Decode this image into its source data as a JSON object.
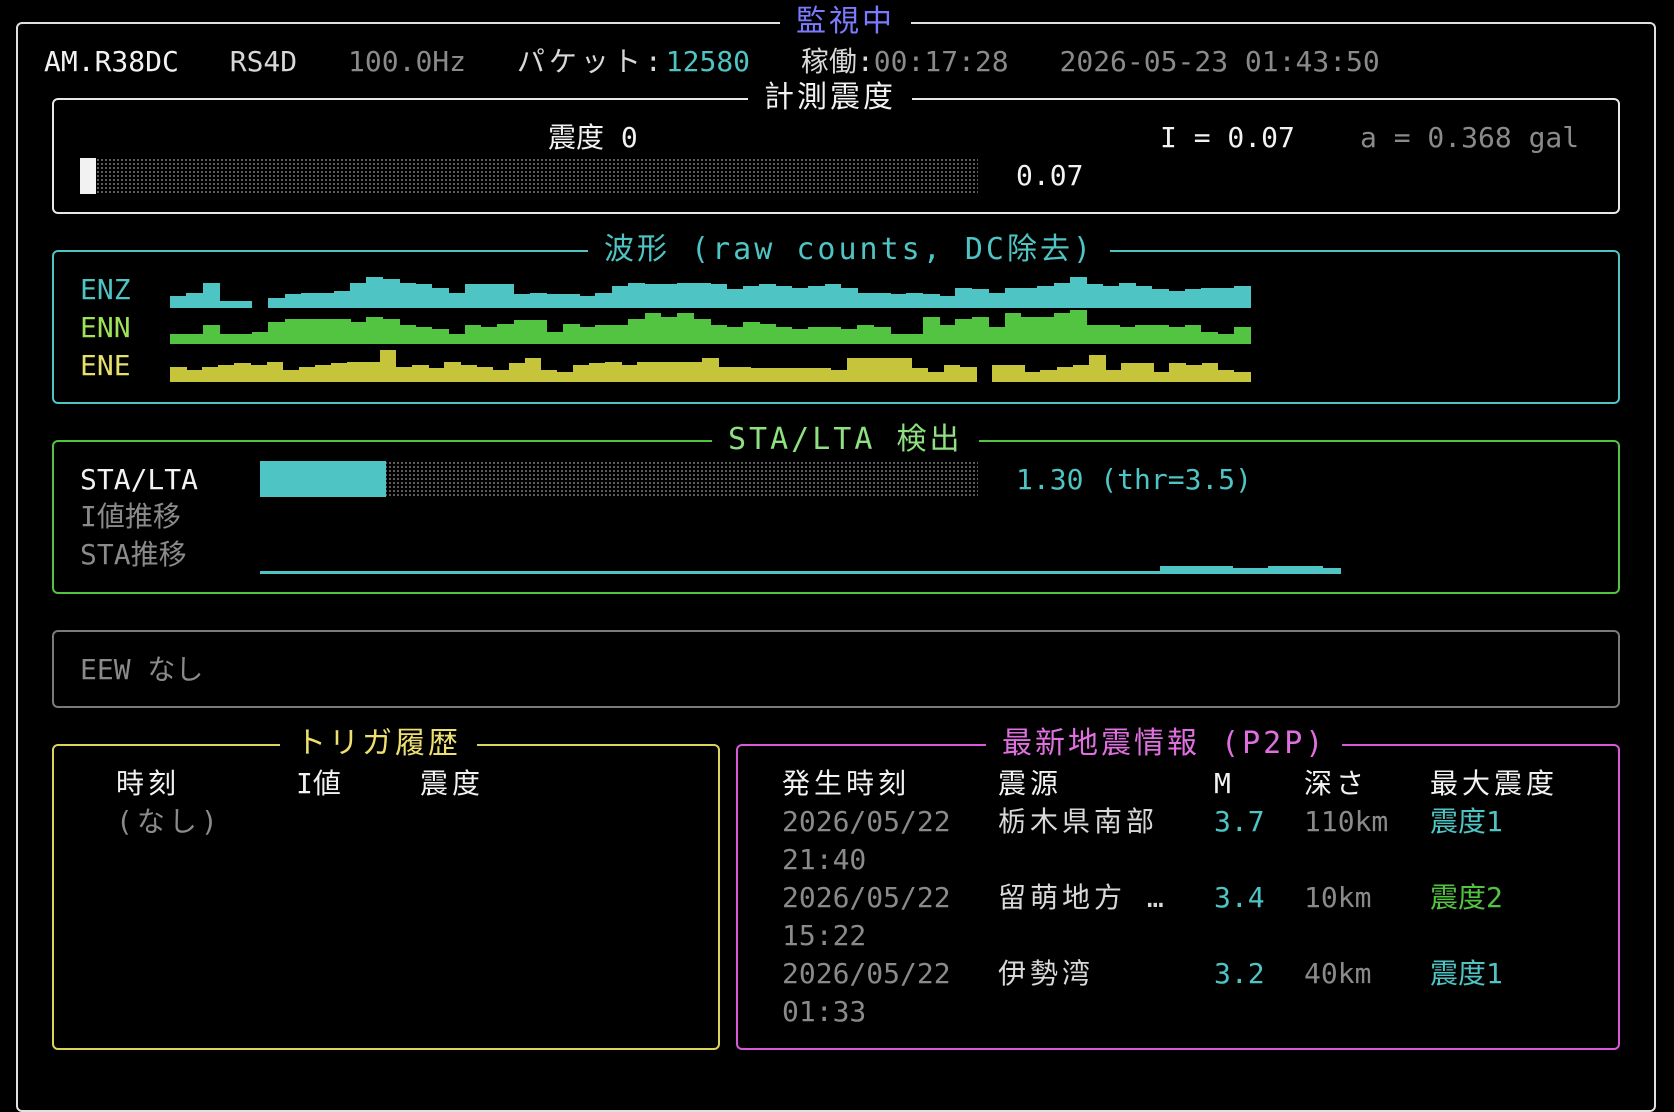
{
  "app": {
    "status_title": "監視中",
    "station": "AM.R38DC",
    "device": "RS4D",
    "rate": "100.0Hz",
    "packet_label": "パケット:",
    "packet_value": "12580",
    "uptime_label": "稼働:",
    "uptime_value": "00:17:28",
    "datetime": "2026-05-23 01:43:50"
  },
  "intensity": {
    "title": "計測震度",
    "shindo_label": "震度 0",
    "i_value_label": "I = 0.07",
    "accel_label": "a = 0.368 gal",
    "bar_value_text": "0.07",
    "bar_fraction": 0.011
  },
  "waveform": {
    "title": "波形 (raw counts, DC除去)",
    "channels": [
      {
        "name": "ENZ",
        "color": "#4fc4c4",
        "bins": [
          0.35,
          0.45,
          0.75,
          0.2,
          0.2,
          0,
          0.3,
          0.4,
          0.45,
          0.45,
          0.5,
          0.75,
          0.9,
          0.85,
          0.75,
          0.7,
          0.6,
          0.45,
          0.7,
          0.7,
          0.7,
          0.4,
          0.45,
          0.4,
          0.4,
          0.35,
          0.45,
          0.65,
          0.75,
          0.7,
          0.7,
          0.75,
          0.75,
          0.7,
          0.55,
          0.65,
          0.7,
          0.65,
          0.6,
          0.65,
          0.7,
          0.6,
          0.45,
          0.45,
          0.4,
          0.45,
          0.4,
          0.35,
          0.6,
          0.55,
          0.45,
          0.6,
          0.6,
          0.65,
          0.75,
          0.9,
          0.7,
          0.65,
          0.75,
          0.65,
          0.55,
          0.5,
          0.55,
          0.6,
          0.6,
          0.65
        ]
      },
      {
        "name": "ENN",
        "color": "#52c441",
        "bins": [
          0.3,
          0.3,
          0.55,
          0.3,
          0.3,
          0.35,
          0.65,
          0.75,
          0.75,
          0.75,
          0.75,
          0.65,
          0.8,
          0.75,
          0.55,
          0.5,
          0.45,
          0.3,
          0.55,
          0.5,
          0.6,
          0.7,
          0.7,
          0.35,
          0.6,
          0.5,
          0.55,
          0.55,
          0.75,
          0.9,
          0.8,
          0.9,
          0.75,
          0.55,
          0.5,
          0.65,
          0.6,
          0.5,
          0.45,
          0.5,
          0.5,
          0.45,
          0.55,
          0.5,
          0.3,
          0.3,
          0.8,
          0.55,
          0.75,
          0.8,
          0.5,
          0.9,
          0.8,
          0.8,
          0.9,
          1.0,
          0.55,
          0.55,
          0.5,
          0.55,
          0.55,
          0.5,
          0.55,
          0.35,
          0.3,
          0.5
        ]
      },
      {
        "name": "ENE",
        "color": "#c6c43b",
        "bins": [
          0.45,
          0.35,
          0.45,
          0.5,
          0.55,
          0.5,
          0.6,
          0.35,
          0.45,
          0.5,
          0.55,
          0.6,
          0.6,
          0.95,
          0.45,
          0.5,
          0.4,
          0.6,
          0.5,
          0.45,
          0.35,
          0.55,
          0.7,
          0.35,
          0.3,
          0.5,
          0.55,
          0.6,
          0.5,
          0.6,
          0.6,
          0.6,
          0.6,
          0.7,
          0.45,
          0.45,
          0.4,
          0.4,
          0.4,
          0.4,
          0.4,
          0.35,
          0.7,
          0.7,
          0.7,
          0.7,
          0.4,
          0.3,
          0.5,
          0.45,
          0,
          0.5,
          0.5,
          0.3,
          0.35,
          0.45,
          0.5,
          0.8,
          0.35,
          0.55,
          0.55,
          0.3,
          0.55,
          0.5,
          0.55,
          0.35,
          0.3
        ]
      }
    ]
  },
  "stalta": {
    "title": "STA/LTA 検出",
    "label": "STA/LTA",
    "value_text": "1.30 (thr=3.5)",
    "fraction": 0.175,
    "i_trend_label": "I値推移",
    "sta_trend_label": "STA推移",
    "sta_trend_bins": [
      0.2,
      0.2,
      0.2,
      0.2,
      0.2,
      0.2,
      0.2,
      0.2,
      0.2,
      0.2,
      0.2,
      0.2,
      0.2,
      0.2,
      0.2,
      0.2,
      0.2,
      0.2,
      0.2,
      0.2,
      0.2,
      0.2,
      0.2,
      0.2,
      0.2,
      0.2,
      0.2,
      0.2,
      0.2,
      0.2,
      0.2,
      0.2,
      0.2,
      0.2,
      0.2,
      0.2,
      0.2,
      0.2,
      0.2,
      0.2,
      0.2,
      0.2,
      0.2,
      0.2,
      0.2,
      0.2,
      0.2,
      0.2,
      0.2,
      0.2,
      0.6,
      0.6,
      0.6,
      0.6,
      0.4,
      0.4,
      0.6,
      0.6,
      0.6,
      0.4
    ]
  },
  "eew": {
    "text": "EEW なし"
  },
  "trigger": {
    "title": "トリガ履歴",
    "col_time": "時刻",
    "col_i": "I値",
    "col_shindo": "震度",
    "empty_text": "(なし)"
  },
  "quake": {
    "title": "最新地震情報 (P2P)",
    "col_time": "発生時刻",
    "col_epicenter": "震源",
    "col_m": "M",
    "col_depth": "深さ",
    "col_max": "最大震度",
    "rows": [
      {
        "date": "2026/05/22",
        "time": "21:40",
        "epicenter": "栃木県南部",
        "m": "3.7",
        "depth": "110km",
        "max": "震度1",
        "max_color": "#4fc4c4"
      },
      {
        "date": "2026/05/22",
        "time": "15:22",
        "epicenter": "留萌地方 …",
        "m": "3.4",
        "depth": "10km",
        "max": "震度2",
        "max_color": "#52c441"
      },
      {
        "date": "2026/05/22",
        "time": "01:33",
        "epicenter": "伊勢湾",
        "m": "3.2",
        "depth": "40km",
        "max": "震度1",
        "max_color": "#4fc4c4"
      }
    ]
  },
  "colors": {
    "outer_border": "#e0e0e0",
    "title_purple": "#7b7bff",
    "cyan": "#4fc4c4",
    "green": "#52c441",
    "yellow": "#dcd45a",
    "magenta": "#d95ad9",
    "gray": "#8a8a8a"
  }
}
